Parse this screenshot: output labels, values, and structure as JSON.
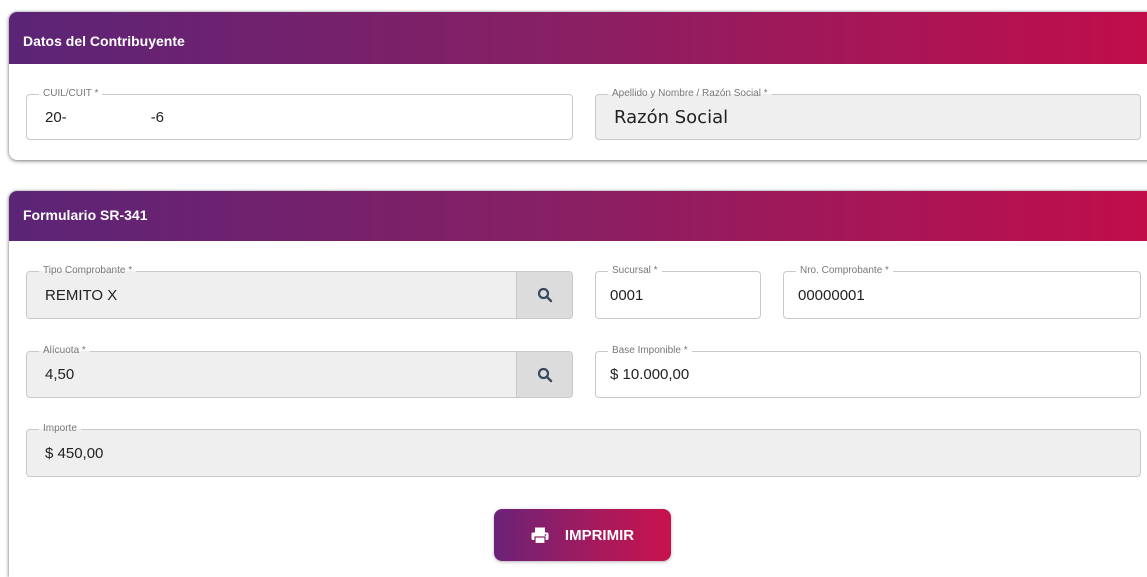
{
  "section_contribuyente": {
    "title": "Datos del Contribuyente",
    "cuil": {
      "label": "CUIL/CUIT *",
      "value_prefix": "20-",
      "value_suffix": "-6"
    },
    "razon_social": {
      "label": "Apellido y Nombre / Razón Social *",
      "value": "Razón Social"
    }
  },
  "section_formulario": {
    "title": "Formulario SR-341",
    "tipo_comprobante": {
      "label": "Tipo Comprobante *",
      "value": "REMITO X",
      "search_icon": "search-icon"
    },
    "sucursal": {
      "label": "Sucursal *",
      "value": "0001"
    },
    "nro_comprobante": {
      "label": "Nro. Comprobante *",
      "value": "00000001"
    },
    "alicuota": {
      "label": "Alícuota *",
      "value": "4,50",
      "search_icon": "search-icon"
    },
    "base_imponible": {
      "label": "Base Imponible *",
      "value": "$ 10.000,00"
    },
    "importe": {
      "label": "Importe",
      "value": "$ 450,00"
    },
    "print_button": {
      "label": "IMPRIMIR",
      "icon": "printer-icon"
    }
  },
  "colors": {
    "header_gradient_start": "#5b2477",
    "header_gradient_end": "#c20d4a",
    "readonly_field_bg": "#efefef"
  }
}
